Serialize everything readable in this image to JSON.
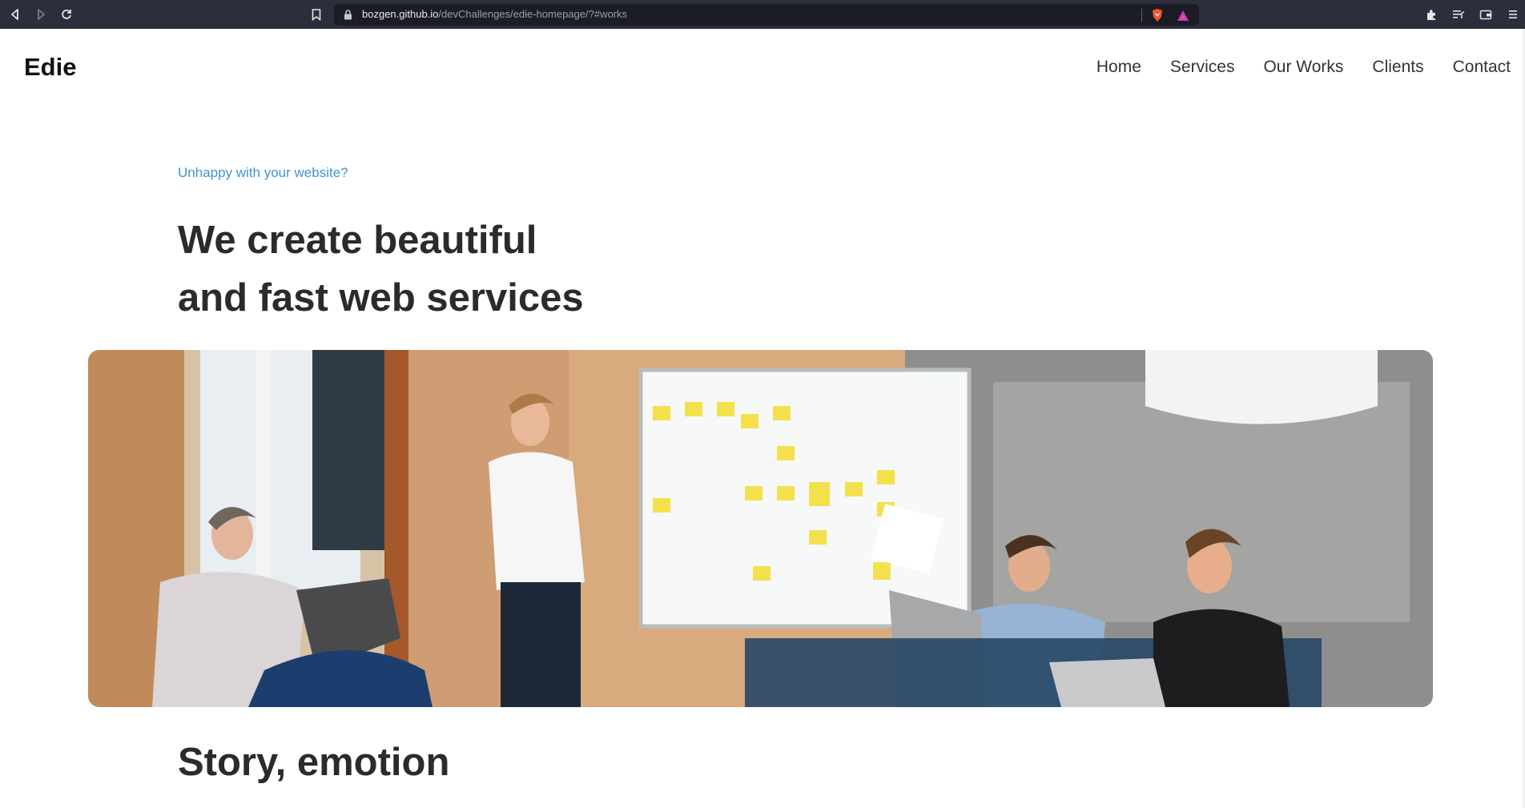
{
  "browser": {
    "url_host": "bozgen.github.io",
    "url_path": "/devChallenges/edie-homepage/?#works",
    "icons": {
      "back": "back-icon",
      "forward": "forward-icon",
      "reload": "reload-icon",
      "bookmark": "bookmark-icon",
      "lock": "lock-icon",
      "brave_shield": "brave-shield-icon",
      "rewards": "rewards-icon",
      "extensions": "extensions-icon",
      "playlist": "playlist-icon",
      "wallet": "wallet-icon",
      "menu": "menu-icon"
    }
  },
  "site": {
    "logo": "Edie",
    "nav": [
      "Home",
      "Services",
      "Our Works",
      "Clients",
      "Contact"
    ]
  },
  "hero": {
    "eyebrow": "Unhappy with your website?",
    "headline_line1": "We create beautiful",
    "headline_line2": "and fast web services",
    "image_alt": "team-meeting-photo"
  },
  "section": {
    "title": "Story, emotion"
  },
  "colors": {
    "accent": "#3f95d1",
    "text_dark": "#2b2b2b",
    "chrome_bg": "#2b2e3b"
  }
}
